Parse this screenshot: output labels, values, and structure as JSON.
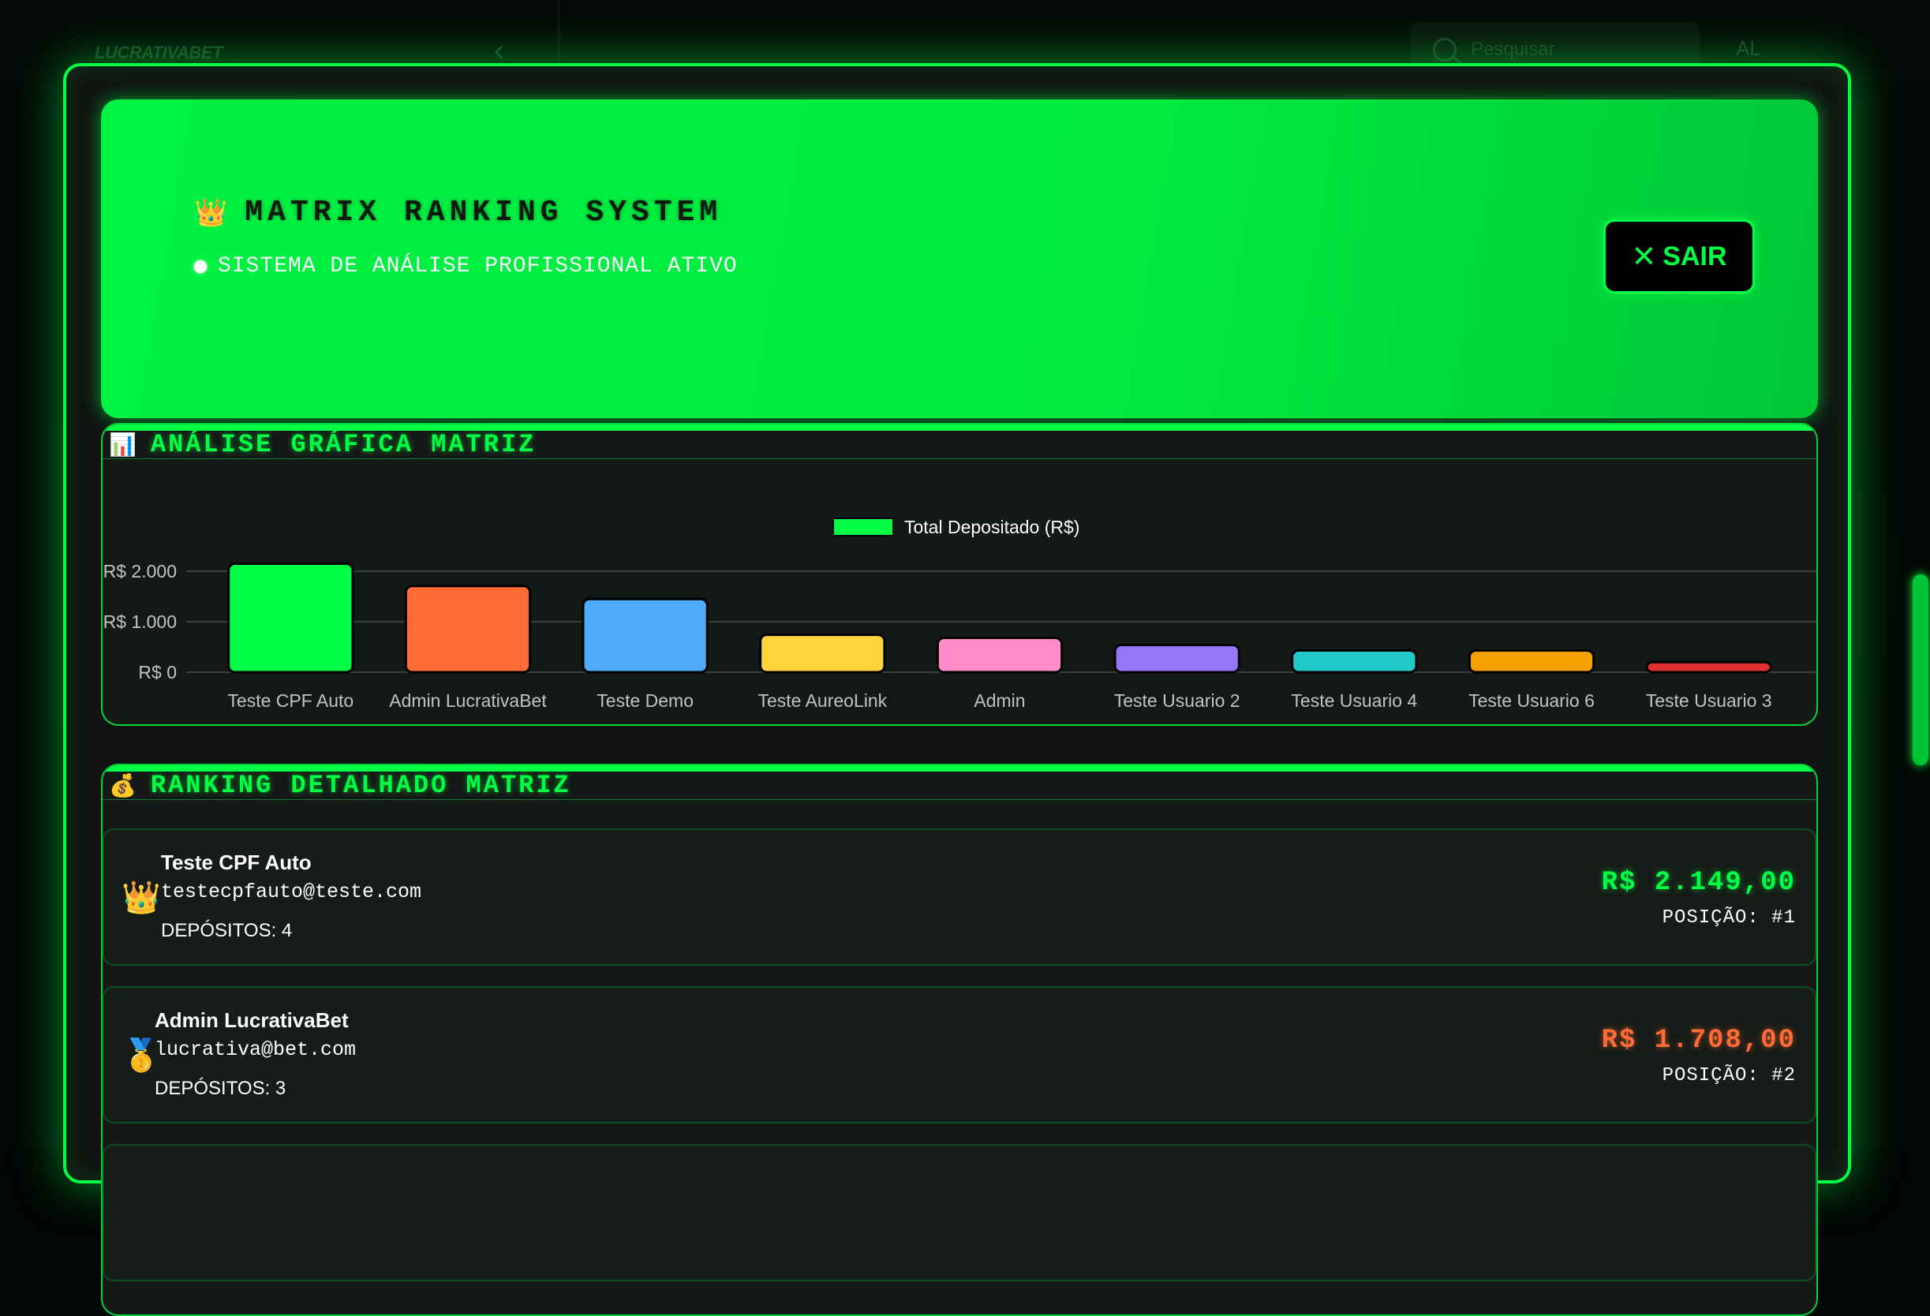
{
  "background": {
    "logo_text": "LUCRATIVABET",
    "search_placeholder": "Pesquisar",
    "avatar_initials": "AL"
  },
  "hero": {
    "title": "MATRIX RANKING SYSTEM",
    "status": "SISTEMA DE ANÁLISE PROFISSIONAL ATIVO",
    "exit_label": "SAIR"
  },
  "chart_section": {
    "title": "ANÁLISE GRÁFICA MATRIZ"
  },
  "chart_data": {
    "type": "bar",
    "categories": [
      "Teste CPF Auto",
      "Admin LucrativaBet",
      "Teste Demo",
      "Teste AureoLink",
      "Admin",
      "Teste Usuario 2",
      "Teste Usuario 4",
      "Teste Usuario 6",
      "Teste Usuario 3"
    ],
    "series": [
      {
        "name": "Total Depositado (R$)",
        "values": [
          2149,
          1708,
          1450,
          740,
          680,
          540,
          430,
          430,
          200
        ],
        "colors": [
          "#00ff44",
          "#ff6b35",
          "#4dabf7",
          "#ffd43b",
          "#ff8cc8",
          "#9775fa",
          "#22c9c9",
          "#f59f00",
          "#e03131"
        ]
      }
    ],
    "y_ticks": [
      "R$ 0",
      "R$ 1.000",
      "R$ 2.000"
    ],
    "ylim": [
      0,
      2000
    ],
    "legend_position": "top-center",
    "grid": true
  },
  "ranking_section": {
    "title": "RANKING DETALHADO MATRIZ",
    "entries": [
      {
        "medal": "👑",
        "name": "Teste CPF Auto",
        "email": "testecpfauto@teste.com",
        "deposits": "DEPÓSITOS: 4",
        "amount": "R$ 2.149,00",
        "position": "POSIÇÃO: #1",
        "amount_color": "#00ff44"
      },
      {
        "medal": "🥇",
        "name": "Admin LucrativaBet",
        "email": "lucrativa@bet.com",
        "deposits": "DEPÓSITOS: 3",
        "amount": "R$ 1.708,00",
        "position": "POSIÇÃO: #2",
        "amount_color": "#ff6b35"
      }
    ]
  }
}
